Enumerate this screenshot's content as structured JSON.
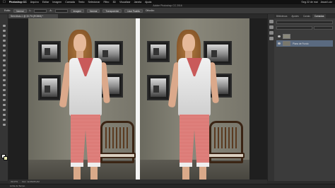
{
  "menubar": {
    "app_name": "Photoshop CC",
    "items": [
      "Arquivo",
      "Editar",
      "Imagem",
      "Camada",
      "Texto",
      "Selecionar",
      "Filtro",
      "3D",
      "Visualizar",
      "Janela",
      "Ajuda"
    ],
    "clock": "Seg 22 de mai",
    "user": "Assai Luiz"
  },
  "window": {
    "title": "Adobe Photoshop CC 2016"
  },
  "options": {
    "style_label": "Estilo:",
    "style_value": "Normal",
    "width_label": "L:",
    "height_label": "A:",
    "buttons": [
      "Imagem",
      "Normal",
      "Transparente",
      "Usar Padrão"
    ],
    "diffusion_label": "Difusão:"
  },
  "document": {
    "tab_title": "Sem título-1 @ 33,7% (RGB/8) *"
  },
  "panel": {
    "tabs": [
      "Bibliotecas",
      "Ajustes",
      "Canais",
      "Camadas"
    ],
    "active_tab": "Camadas",
    "layers": [
      {
        "name": ""
      },
      {
        "name": "Plano de Fundo"
      }
    ]
  },
  "status": {
    "zoom": "33,67%",
    "doc_size": "Doc: 12,6M/25,2M"
  },
  "timeline": {
    "label": "Linha do Tempo"
  },
  "colors": {
    "foreground": "#f2f2f2",
    "background": "#e8e8b0",
    "accent": "#5a6a80"
  }
}
